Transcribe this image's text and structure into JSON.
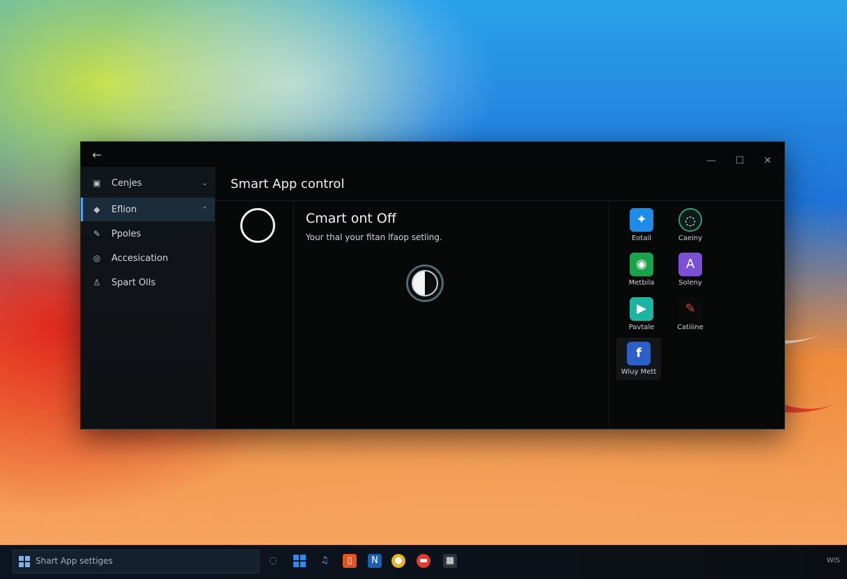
{
  "window": {
    "title": "Smart App control",
    "back_icon": "←",
    "minimize_icon": "—",
    "maximize_icon": "☐",
    "close_icon": "✕"
  },
  "sidebar": {
    "items": [
      {
        "label": "Cenjes",
        "icon": "▣",
        "chev": "⌄",
        "active": false
      },
      {
        "label": "Eflion",
        "icon": "◆",
        "chev": "⌃",
        "active": true
      },
      {
        "label": "Ppoles",
        "icon": "✎",
        "chev": "",
        "active": false
      },
      {
        "label": "Accesication",
        "icon": "◎",
        "chev": "",
        "active": false
      },
      {
        "label": "Spart Olls",
        "icon": "♙",
        "chev": "",
        "active": false
      }
    ]
  },
  "status": {
    "title": "Cmart ont Off",
    "description": "Your thal your fitan lfaop setling."
  },
  "apps": [
    {
      "label": "Eotail",
      "glyph": "✦",
      "color": "#1e8be6"
    },
    {
      "label": "Caeiny",
      "glyph": "◌",
      "color": "#0b1c19"
    },
    {
      "label": "Metbila",
      "glyph": "◉",
      "color": "#19a34a"
    },
    {
      "label": "Soleny",
      "glyph": "A",
      "color": "#7b4fd6"
    },
    {
      "label": "Pavtale",
      "glyph": "▶",
      "color": "#1bb6a2"
    },
    {
      "label": "Catiiine",
      "glyph": "✎",
      "color": "#0a0a0a"
    },
    {
      "label": "Wiuy Mett",
      "glyph": "f",
      "color": "#2c5fc8"
    }
  ],
  "taskbar": {
    "search_text": "Shart App settiges",
    "tray_text": "WIS"
  },
  "colors": {
    "accent": "#4aa3ff",
    "window_bg": "#060708",
    "sidebar_active": "#1b2c3b"
  }
}
